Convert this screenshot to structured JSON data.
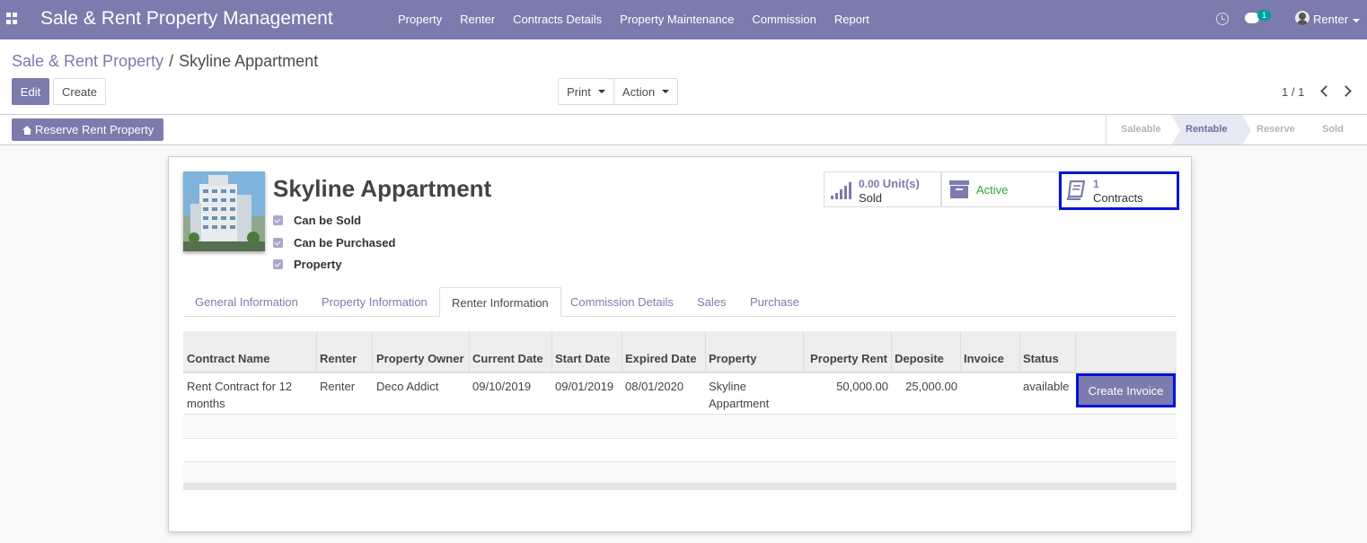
{
  "navbar": {
    "brand": "Sale & Rent Property Management",
    "menu": [
      "Property",
      "Renter",
      "Contracts Details",
      "Property Maintenance",
      "Commission",
      "Report"
    ],
    "chat_badge": "1",
    "user": "Renter"
  },
  "breadcrumb": {
    "parent": "Sale & Rent Property",
    "separator": "/",
    "current": "Skyline Appartment"
  },
  "buttons": {
    "edit": "Edit",
    "create": "Create",
    "print": "Print",
    "action": "Action",
    "reserve": "Reserve Rent Property"
  },
  "pager": "1 / 1",
  "stages": [
    {
      "label": "Saleable",
      "active": false
    },
    {
      "label": "Rentable",
      "active": true
    },
    {
      "label": "Reserve",
      "active": false
    },
    {
      "label": "Sold",
      "active": false
    }
  ],
  "property": {
    "title": "Skyline Appartment",
    "checks": [
      "Can be Sold",
      "Can be Purchased",
      "Property"
    ]
  },
  "smart_buttons": {
    "sold": {
      "value": "0.00",
      "unit": "Unit(s)",
      "label": "Sold"
    },
    "active": {
      "label": "Active"
    },
    "contracts": {
      "value": "1",
      "label": "Contracts"
    }
  },
  "tabs": [
    "General Information",
    "Property Information",
    "Renter Information",
    "Commission Details",
    "Sales",
    "Purchase"
  ],
  "active_tab": "Renter Information",
  "table": {
    "headers": [
      "Contract Name",
      "Renter",
      "Property Owner",
      "Current Date",
      "Start Date",
      "Expired Date",
      "Property",
      "Property Rent",
      "Deposite",
      "Invoice",
      "Status"
    ],
    "rows": [
      {
        "contract_name": "Rent Contract for 12 months",
        "renter": "Renter",
        "owner": "Deco Addict",
        "current_date": "09/10/2019",
        "start_date": "09/01/2019",
        "expired_date": "08/01/2020",
        "property": "Skyline Appartment",
        "rent": "50,000.00",
        "deposite": "25,000.00",
        "invoice": "",
        "status": "available",
        "action": "Create Invoice"
      }
    ]
  },
  "colors": {
    "primary": "#7c7bad",
    "highlight": "#0015d6",
    "active_green": "#28a745"
  }
}
